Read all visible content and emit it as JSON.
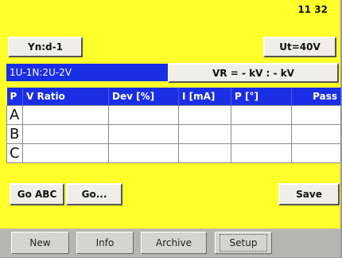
{
  "status": {
    "clock": "11 32"
  },
  "toolbar": {
    "vector_group": "Yn:d-1",
    "test_voltage": "Ut=40V"
  },
  "connection": {
    "label": "1U-1N:2U-2V",
    "voltage_ratio": "VR = - kV : - kV"
  },
  "table": {
    "headers": [
      "P",
      "V Ratio",
      "Dev [%]",
      "I [mA]",
      "P [°]",
      "Pass"
    ],
    "rows": [
      {
        "phase": "A",
        "v_ratio": "",
        "dev": "",
        "current": "",
        "phase_angle": "",
        "pass": ""
      },
      {
        "phase": "B",
        "v_ratio": "",
        "dev": "",
        "current": "",
        "phase_angle": "",
        "pass": ""
      },
      {
        "phase": "C",
        "v_ratio": "",
        "dev": "",
        "current": "",
        "phase_angle": "",
        "pass": ""
      }
    ]
  },
  "actions": {
    "go_abc": "Go ABC",
    "go": "Go...",
    "save": "Save"
  },
  "tabs": {
    "new": "New",
    "info": "Info",
    "archive": "Archive",
    "setup": "Setup"
  },
  "colors": {
    "background": "#ffff2a",
    "header_blue": "#1a2ee6",
    "button_face": "#f0eee6",
    "tabbar": "#b6b6b0"
  }
}
